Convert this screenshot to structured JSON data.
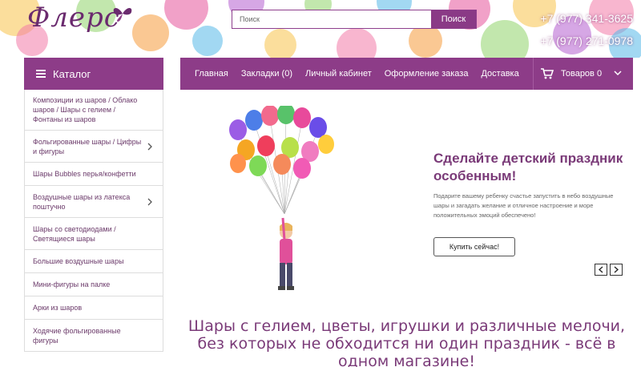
{
  "header": {
    "logo_text": "Флерс",
    "search": {
      "placeholder": "Поиск",
      "button_label": "Поиск"
    },
    "phones": [
      "+7 (977) 341-3625",
      "+7 (977) 271-0978"
    ]
  },
  "catalog": {
    "title": "Каталог",
    "items": [
      {
        "label": "Композиции из шаров / Облако шаров / Шары с гелием / Фонтаны из шаров",
        "has_children": false
      },
      {
        "label": "Фольгированные шары / Цифры и фигуры",
        "has_children": true
      },
      {
        "label": "Шары Bubbles перья/конфетти",
        "has_children": false
      },
      {
        "label": "Воздушные шары из латекса поштучно",
        "has_children": true
      },
      {
        "label": "Шары со светодиодами / Светящиеся шары",
        "has_children": false
      },
      {
        "label": "Большие воздушные шары",
        "has_children": false
      },
      {
        "label": "Мини-фигуры на палке",
        "has_children": false
      },
      {
        "label": "Арки из шаров",
        "has_children": false
      },
      {
        "label": "Ходячие фольгированные фигуры",
        "has_children": false
      }
    ]
  },
  "nav": {
    "items": [
      "Главная",
      "Закладки (0)",
      "Личный кабинет",
      "Оформление заказа",
      "Доставка"
    ],
    "cart_label": "Товаров 0",
    "icons": {
      "cart": "cart-icon",
      "menu": "menu-icon",
      "dropdown": "chevron-down-icon"
    }
  },
  "slide": {
    "title": "Сделайте детский праздник особенным!",
    "text": "Подарите вашему ребенку счастье запустить в небо воздушные шары и загадать желание и отличное настроение и море положительных эмоций обеспечено!",
    "button_label": "Купить сейчас!"
  },
  "headline": "Шары с гелием, цветы, игрушки и различные мелочи, без которых не обходится ни один праздник - всё в одном магазине!",
  "colors": {
    "brand_purple": "#8d3c88",
    "text_purple": "#7a3a78"
  }
}
